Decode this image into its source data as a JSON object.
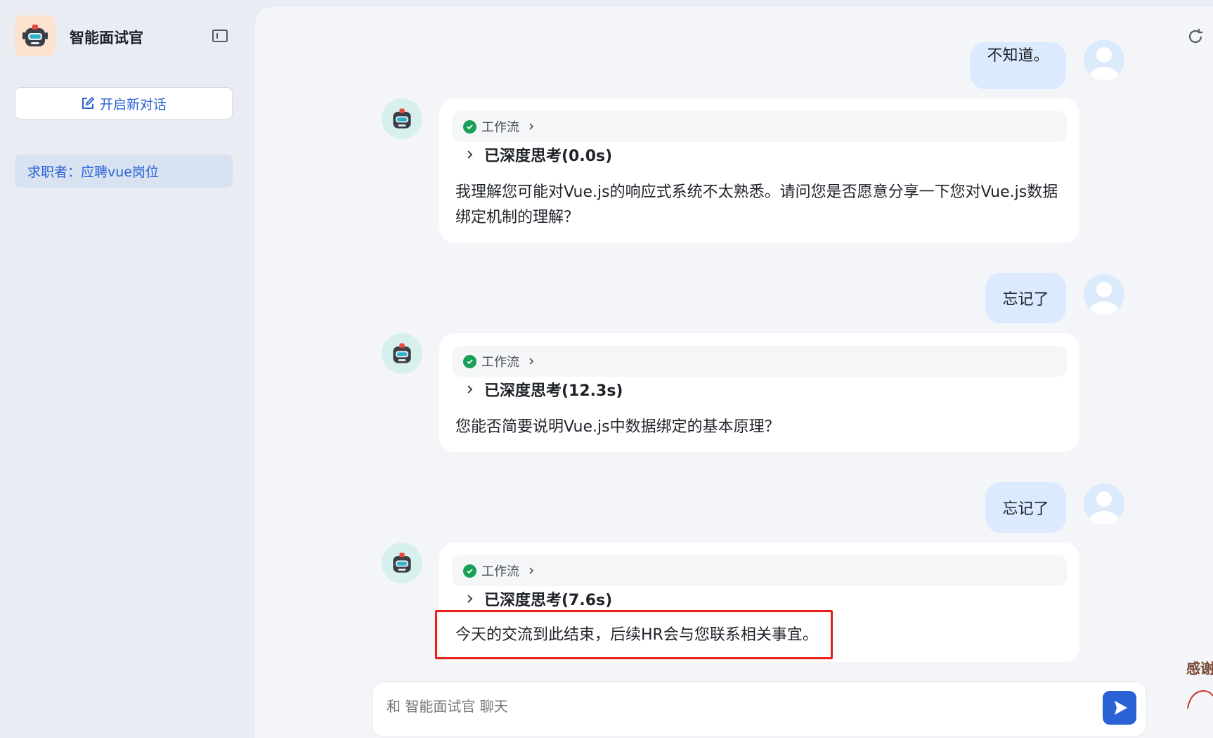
{
  "sidebar": {
    "app_title": "智能面试官",
    "new_chat_label": "开启新对话",
    "conversations": [
      {
        "label": "求职者：应聘vue岗位"
      }
    ]
  },
  "messages": {
    "user_top_partial": "不知道。",
    "bot1": {
      "workflow_label": "工作流",
      "think_label": "已深度思考(0.0s)",
      "answer": "我理解您可能对Vue.js的响应式系统不太熟悉。请问您是否愿意分享一下您对Vue.js数据绑定机制的理解？"
    },
    "user1": "忘记了",
    "bot2": {
      "workflow_label": "工作流",
      "think_label": "已深度思考(12.3s)",
      "answer": "您能否简要说明Vue.js中数据绑定的基本原理？"
    },
    "user2": "忘记了",
    "bot3": {
      "workflow_label": "工作流",
      "think_label": "已深度思考(7.6s)",
      "answer": "今天的交流到此结束，后续HR会与您联系相关事宜。"
    }
  },
  "input": {
    "placeholder": "和 智能面试官 聊天"
  },
  "deco_text": "感谢"
}
